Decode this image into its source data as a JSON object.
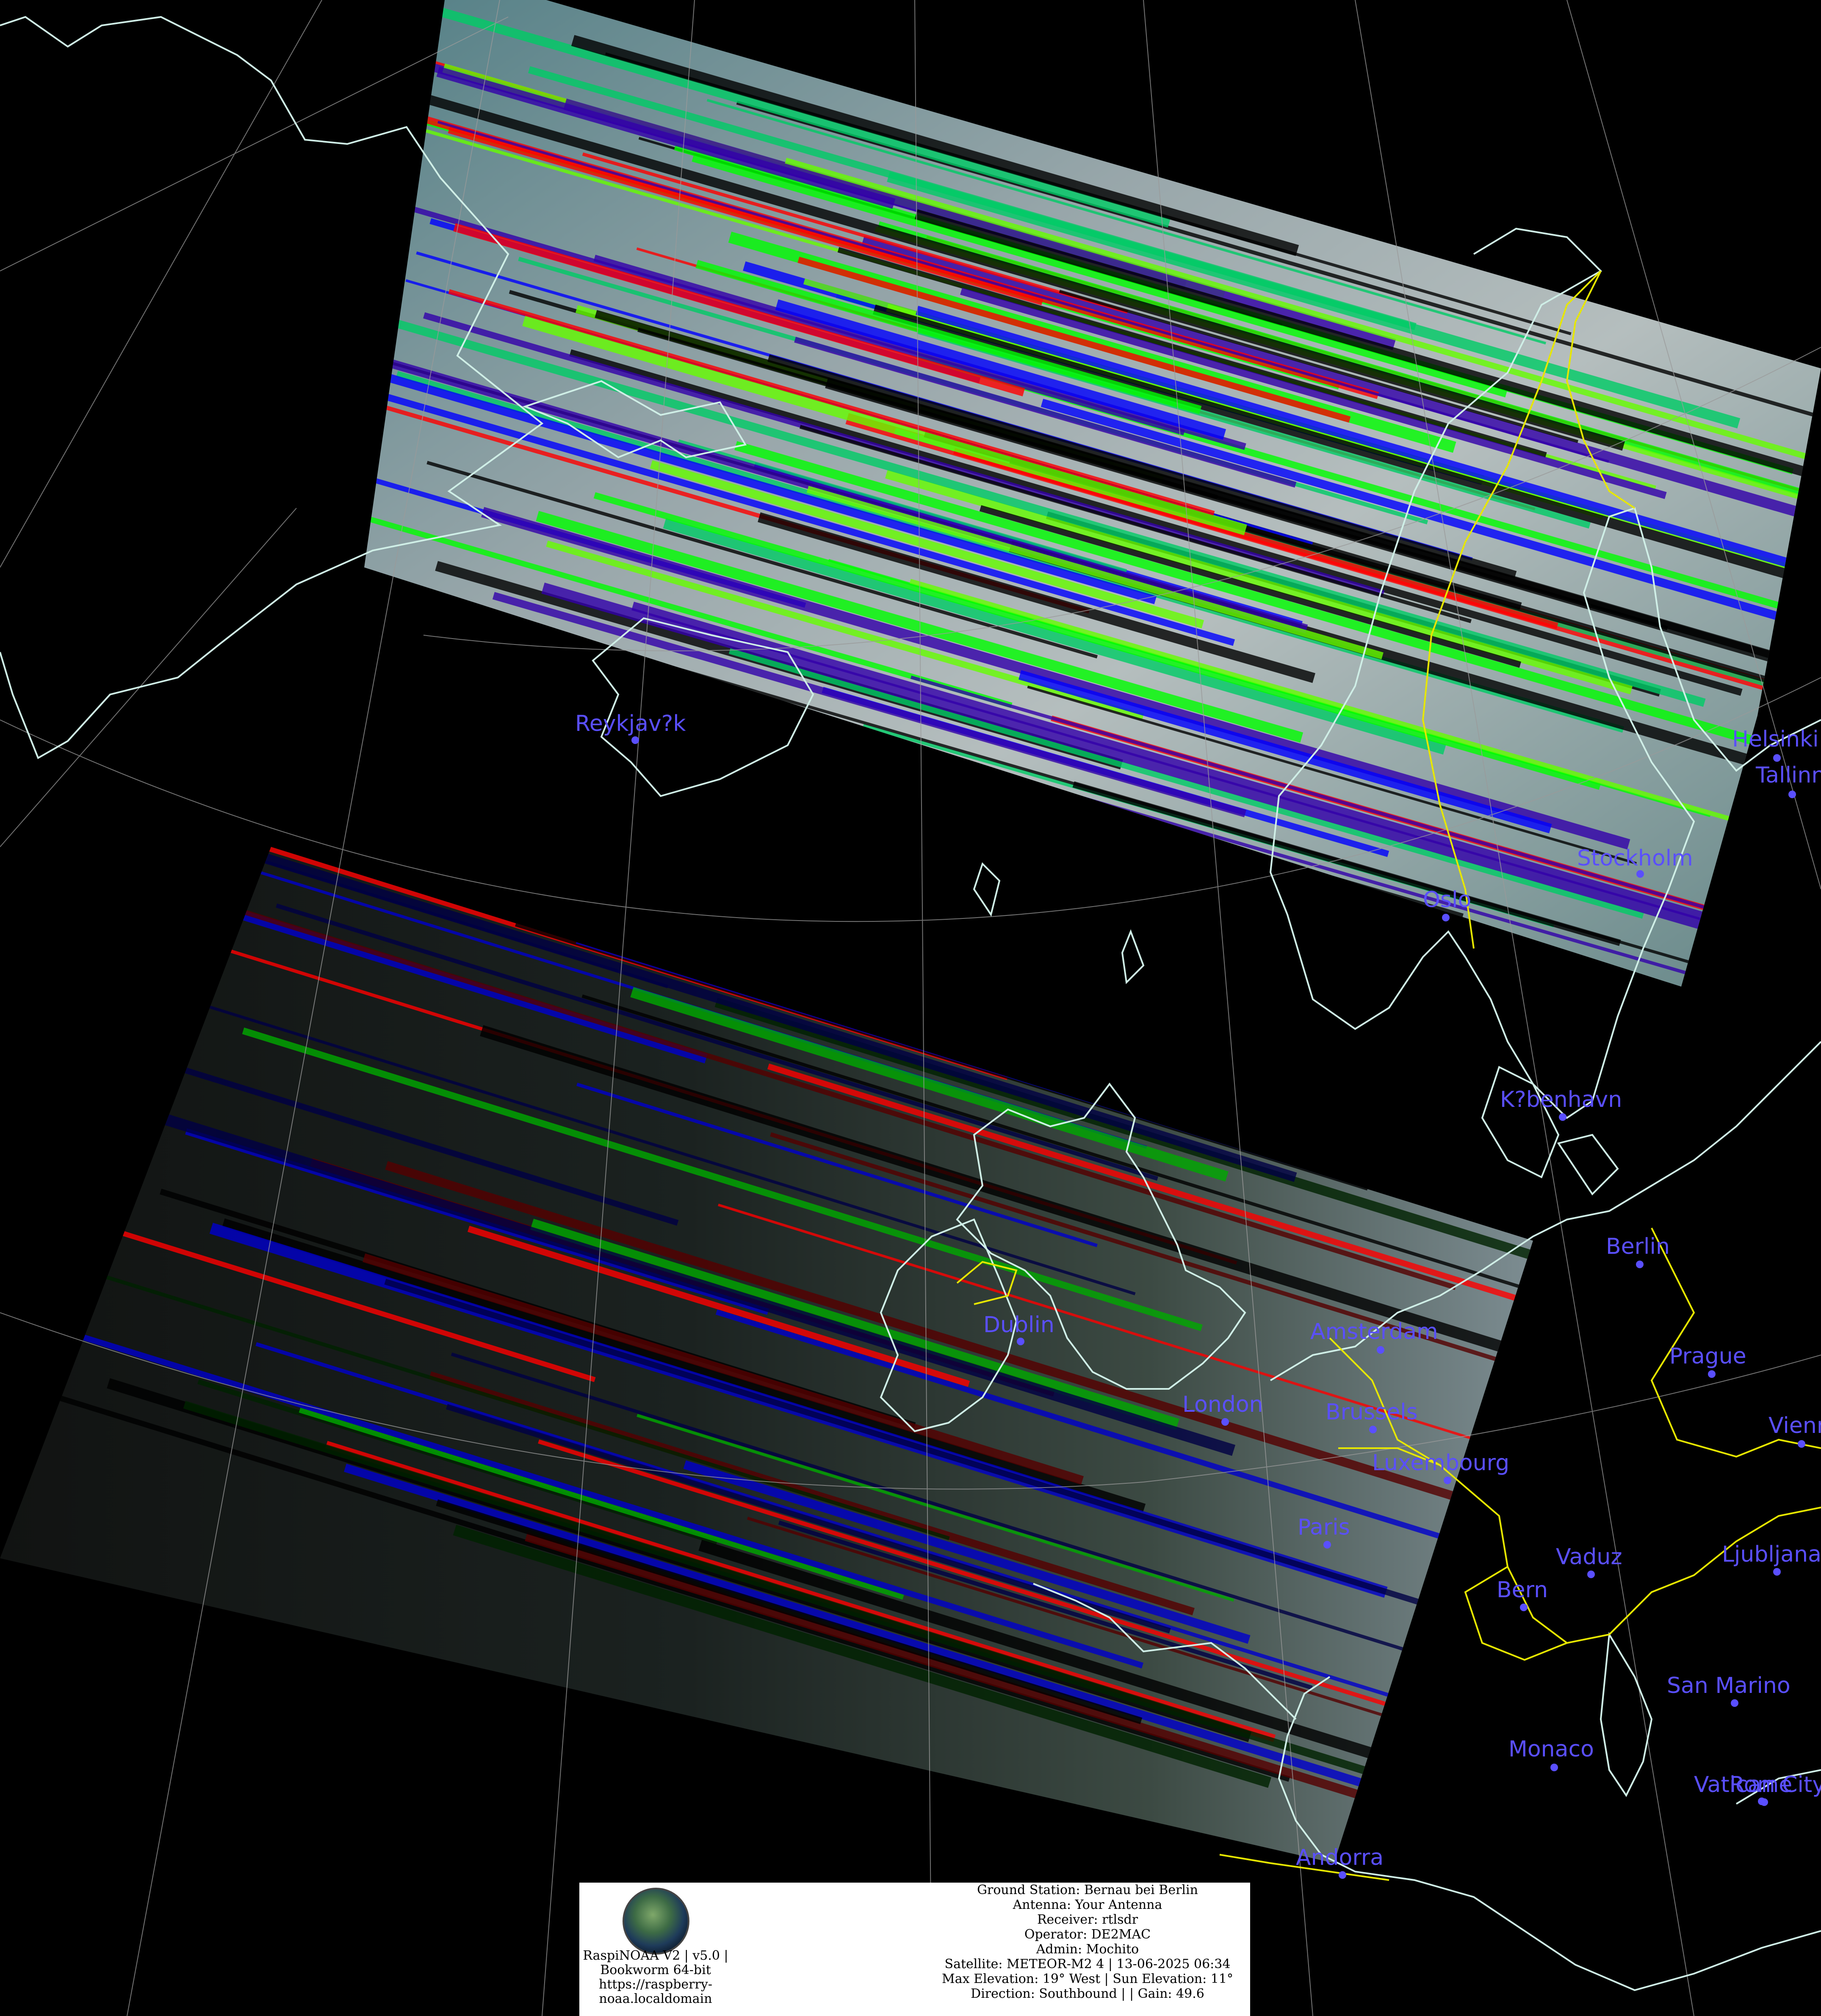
{
  "cities": [
    {
      "name": "Reykjav?k"
    },
    {
      "name": "Helsinki"
    },
    {
      "name": "Tallinn"
    },
    {
      "name": "Stockholm"
    },
    {
      "name": "Oslo"
    },
    {
      "name": "K?benhavn"
    },
    {
      "name": "Berlin"
    },
    {
      "name": "Dublin"
    },
    {
      "name": "Amsterdam"
    },
    {
      "name": "Prague"
    },
    {
      "name": "London"
    },
    {
      "name": "Brussels"
    },
    {
      "name": "Luxembourg"
    },
    {
      "name": "Vienna"
    },
    {
      "name": "Paris"
    },
    {
      "name": "Vaduz"
    },
    {
      "name": "Bern"
    },
    {
      "name": "Ljubljana"
    },
    {
      "name": "San Marino"
    },
    {
      "name": "Monaco"
    },
    {
      "name": "Vatican City"
    },
    {
      "name": "Rome"
    },
    {
      "name": "Andorra"
    }
  ],
  "colors": {
    "coastline": "#cfeee6",
    "border": "#e6e600",
    "graticule": "#9a9a9a",
    "city": "#5a4fff",
    "background": "#000000"
  },
  "info_box": {
    "software": [
      "RaspiNOAA V2 | v5.0 |",
      "Bookworm 64-bit",
      "https://raspberry-",
      "noaa.localdomain"
    ],
    "station": [
      "Ground Station: Bernau bei Berlin",
      "Antenna: Your Antenna",
      "Receiver: rtlsdr",
      "Operator: DE2MAC",
      "Admin: Mochito",
      "Satellite: METEOR-M2 4 | 13-06-2025 06:34",
      "Max Elevation: 19° West | Sun Elevation: 11°",
      "Direction: Southbound | | Gain: 49.6"
    ],
    "logo": "satellite-globe-logo"
  }
}
